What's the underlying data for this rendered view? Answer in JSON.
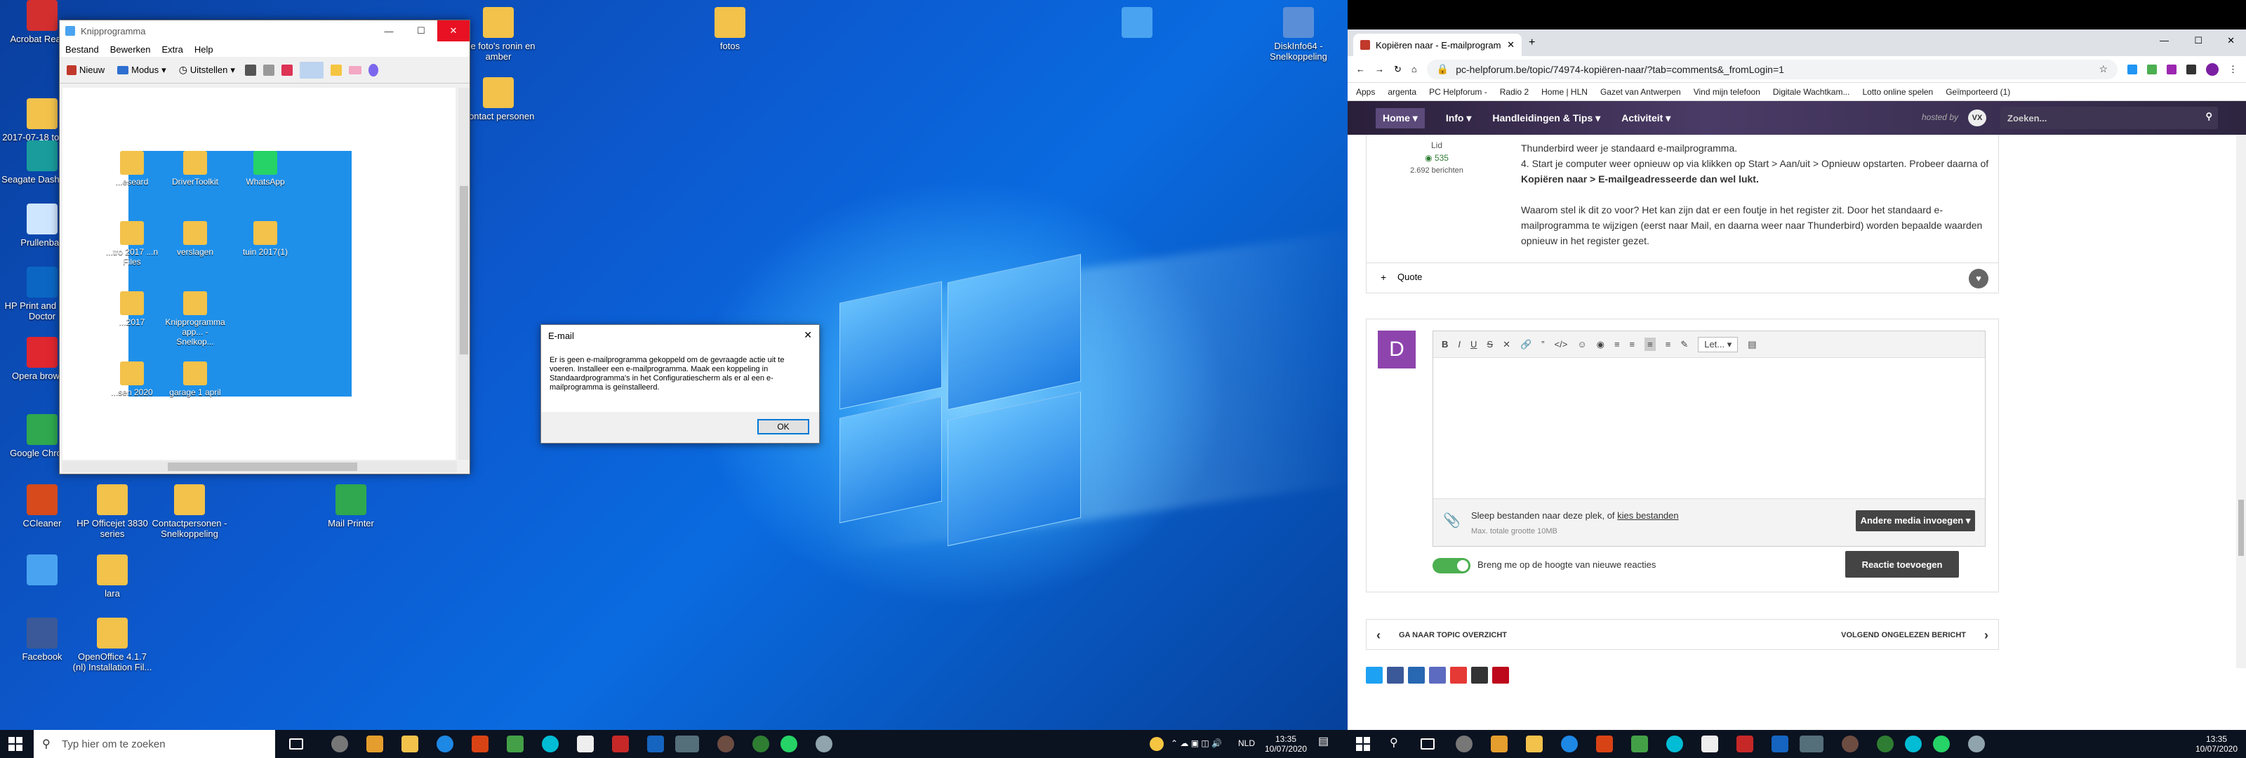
{
  "desktop": {
    "icons": [
      {
        "label": "Acrobat Reader",
        "color": "#d32f2f"
      },
      {
        "label": "2017-07-18 to 2017",
        "color": "#f2c24b"
      },
      {
        "label": "Seagate Dashboard",
        "color": "#1a9c9c"
      },
      {
        "label": "Prullenbak",
        "color": "#cfe6ff"
      },
      {
        "label": "HP Print and Scan Doctor",
        "color": "#0b66c3"
      },
      {
        "label": "Opera browser",
        "color": "#e0262f"
      },
      {
        "label": "Google Chrome",
        "color": "#2fa84f"
      },
      {
        "label": "CCleaner",
        "color": "#d64a1c"
      },
      {
        "label": "HP Officejet 3830 series",
        "color": "#f2c24b"
      },
      {
        "label": "Contactpersonen - Snelkoppeling",
        "color": "#f2c24b"
      },
      {
        "label": "Mail Printer",
        "color": "#2fa84f"
      },
      {
        "label": "",
        "color": "#4aa3f0"
      },
      {
        "label": "lara",
        "color": "#f2c24b"
      },
      {
        "label": "Facebook",
        "color": "#3b5998"
      },
      {
        "label": "OpenOffice 4.1.7 (nl) Installation Fil...",
        "color": "#f2c24b"
      },
      {
        "label": "alle foto's ronin en amber",
        "color": "#f2c24b"
      },
      {
        "label": "Contact personen",
        "color": "#f2c24b"
      },
      {
        "label": "fotos",
        "color": "#f2c24b"
      },
      {
        "label": "",
        "color": "#4aa3f0"
      },
      {
        "label": "DiskInfo64 - Snelkoppeling",
        "color": "#5a8fd8"
      }
    ]
  },
  "kropp": {
    "title": "Knipprogramma",
    "menu": [
      "Bestand",
      "Bewerken",
      "Extra",
      "Help"
    ],
    "tools": {
      "new": "Nieuw",
      "mode": "Modus",
      "delay": "Uitstellen"
    },
    "snip_icons": [
      "...eseard",
      "DriverToolkit",
      "WhatsApp",
      "...tro 2017 ...n Files",
      "verslagen",
      "tuin 2017(1)",
      "...2017",
      "Knipprogramma app... - Snelkop...",
      "...sen 2020",
      "garage 1 april"
    ]
  },
  "dialog": {
    "title": "E-mail",
    "message": "Er is geen e-mailprogramma gekoppeld om de gevraagde actie uit te voeren. Installeer een e-mailprogramma. Maak een koppeling in Standaardprogramma's in het Configuratiescherm als er al een e-mailprogramma is geïnstalleerd.",
    "ok": "OK"
  },
  "taskbar1": {
    "search_placeholder": "Typ hier om te zoeken",
    "lang": "NLD",
    "time": "13:35",
    "date": "10/07/2020"
  },
  "browser": {
    "tab_title": "Kopiëren naar - E-mailprogramm",
    "url": "pc-helpforum.be/topic/74974-kopiëren-naar/?tab=comments&_fromLogin=1",
    "bookmarks": [
      "Apps",
      "argenta",
      "PC Helpforum -",
      "Radio 2",
      "Home | HLN",
      "Gazet van Antwerpen",
      "Vind mijn telefoon",
      "Digitale Wachtkam...",
      "Lotto online spelen",
      "Geïmporteerd (1)"
    ],
    "nav": [
      "Home ▾",
      "Info ▾",
      "Handleidingen & Tips ▾",
      "Activiteit ▾"
    ],
    "hosted": "hosted by",
    "search": "Zoeken...",
    "author": {
      "role": "Lid",
      "points": "535",
      "posts": "2.692 berichten"
    },
    "post_lines": [
      "Thunderbird weer je standaard e-mailprogramma.",
      "4. Start je computer weer opnieuw op via klikken op Start > Aan/uit > Opnieuw opstarten. Probeer daarna of",
      "Kopiëren naar > E-mailgeadresseerde dan wel lukt.",
      "",
      "Waarom stel ik dit zo voor? Het kan zijn dat er een foutje in het register zit. Door het standaard e-",
      "mailprogramma te wijzigen (eerst naar Mail, en daarna weer naar Thunderbird) worden bepaalde waarden",
      "opnieuw in het register gezet."
    ],
    "quote": "Quote",
    "avatar": "D",
    "font_sel": "Let...",
    "drop_text": "Sleep bestanden naar deze plek, of",
    "drop_link": "kies bestanden",
    "max_size": "Max. totale grootte 10MB",
    "other_media": "Andere media invoegen ▾",
    "notify": "Breng me op de hoogte van nieuwe reacties",
    "submit": "Reactie toevoegen",
    "prev": "GA NAAR TOPIC OVERZICHT",
    "next": "VOLGEND ONGELEZEN BERICHT"
  },
  "taskbar2": {
    "time": "13:35",
    "date": "10/07/2020"
  }
}
